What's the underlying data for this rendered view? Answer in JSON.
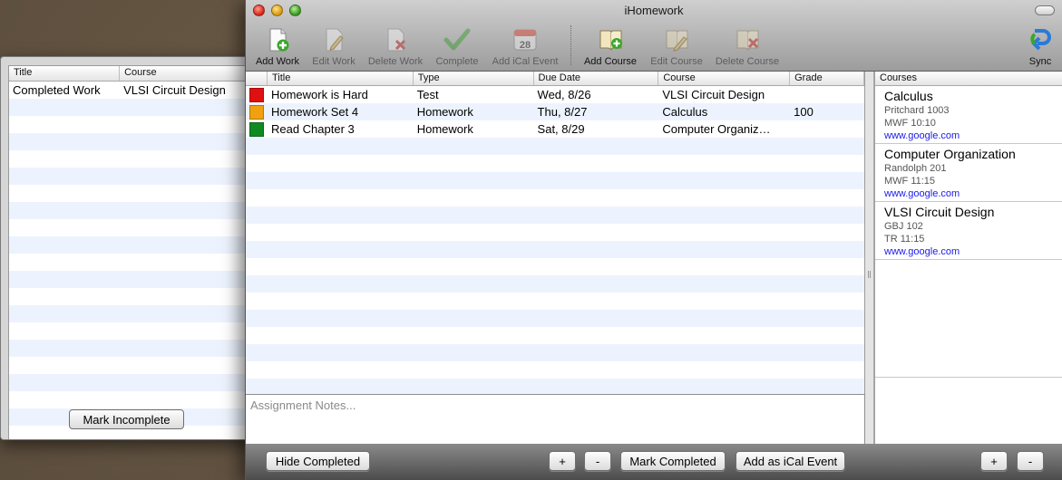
{
  "completed_window": {
    "columns": [
      "Title",
      "Course"
    ],
    "rows": [
      {
        "title": "Completed Work",
        "course": "VLSI Circuit Design"
      }
    ],
    "mark_incomplete_label": "Mark Incomplete"
  },
  "main_window": {
    "title": "iHomework",
    "toolbar": {
      "add_work": "Add Work",
      "edit_work": "Edit Work",
      "delete_work": "Delete Work",
      "complete": "Complete",
      "add_ical": "Add iCal Event",
      "add_course": "Add Course",
      "edit_course": "Edit Course",
      "delete_course": "Delete Course",
      "sync": "Sync",
      "calendar_day": "28"
    },
    "work_table": {
      "columns": [
        "Title",
        "Type",
        "Due Date",
        "Course",
        "Grade"
      ],
      "rows": [
        {
          "color": "#e01010",
          "title": "Homework is Hard",
          "type": "Test",
          "due": "Wed, 8/26",
          "course": "VLSI Circuit Design",
          "grade": ""
        },
        {
          "color": "#f0a010",
          "title": "Homework Set 4",
          "type": "Homework",
          "due": "Thu, 8/27",
          "course": "Calculus",
          "grade": "100"
        },
        {
          "color": "#108a20",
          "title": "Read Chapter 3",
          "type": "Homework",
          "due": "Sat, 8/29",
          "course": "Computer Organiz…",
          "grade": ""
        }
      ]
    },
    "notes_placeholder": "Assignment Notes...",
    "bottom": {
      "hide_completed": "Hide Completed",
      "plus": "+",
      "minus": "-",
      "mark_completed": "Mark Completed",
      "add_ical": "Add as iCal Event"
    },
    "courses": {
      "header": "Courses",
      "items": [
        {
          "name": "Calculus",
          "room": "Pritchard 1003",
          "time": "MWF 10:10",
          "link": "www.google.com"
        },
        {
          "name": "Computer Organization",
          "room": "Randolph 201",
          "time": "MWF 11:15",
          "link": "www.google.com"
        },
        {
          "name": "VLSI Circuit Design",
          "room": "GBJ 102",
          "time": "TR 11:15",
          "link": "www.google.com"
        }
      ],
      "plus": "+",
      "minus": "-"
    }
  }
}
